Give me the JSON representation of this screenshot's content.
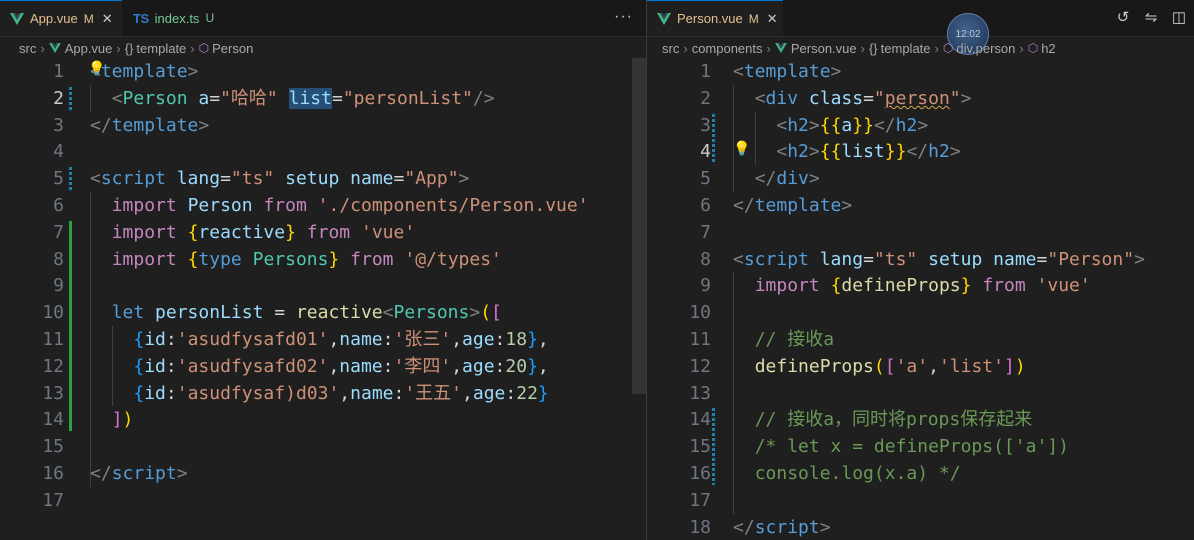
{
  "left": {
    "tabs": [
      {
        "name": "App.vue",
        "status": "M",
        "kind": "vue",
        "active": true
      },
      {
        "name": "index.ts",
        "status": "U",
        "kind": "ts",
        "active": false
      }
    ],
    "more": "···",
    "breadcrumb": [
      "src",
      "App.vue",
      "template",
      "Person"
    ],
    "lines": [
      {
        "n": "1",
        "tokens": [
          [
            "t-punc",
            "<"
          ],
          [
            "t-tag",
            "template"
          ],
          [
            "t-punc",
            ">"
          ]
        ]
      },
      {
        "n": "2",
        "tokens": [
          [
            "t-def",
            "  "
          ],
          [
            "t-punc",
            "<"
          ],
          [
            "t-type",
            "Person"
          ],
          [
            "t-def",
            " "
          ],
          [
            "t-attr",
            "a"
          ],
          [
            "t-def",
            "="
          ],
          [
            "t-str",
            "\"哈哈\""
          ],
          [
            "t-def",
            " "
          ],
          [
            "t-attr hl",
            "list"
          ],
          [
            "t-def",
            "="
          ],
          [
            "t-str",
            "\"personList\""
          ],
          [
            "t-punc",
            "/>"
          ]
        ]
      },
      {
        "n": "3",
        "tokens": [
          [
            "t-punc",
            "</"
          ],
          [
            "t-tag",
            "template"
          ],
          [
            "t-punc",
            ">"
          ]
        ]
      },
      {
        "n": "4",
        "tokens": []
      },
      {
        "n": "5",
        "tokens": [
          [
            "t-punc",
            "<"
          ],
          [
            "t-tag",
            "script"
          ],
          [
            "t-def",
            " "
          ],
          [
            "t-attr",
            "lang"
          ],
          [
            "t-def",
            "="
          ],
          [
            "t-str",
            "\"ts\""
          ],
          [
            "t-def",
            " "
          ],
          [
            "t-attr",
            "setup"
          ],
          [
            "t-def",
            " "
          ],
          [
            "t-attr",
            "name"
          ],
          [
            "t-def",
            "="
          ],
          [
            "t-str",
            "\"App\""
          ],
          [
            "t-punc",
            ">"
          ]
        ]
      },
      {
        "n": "6",
        "tokens": [
          [
            "t-def",
            "  "
          ],
          [
            "t-kw",
            "import"
          ],
          [
            "t-def",
            " "
          ],
          [
            "t-var",
            "Person"
          ],
          [
            "t-def",
            " "
          ],
          [
            "t-kw",
            "from"
          ],
          [
            "t-def",
            " "
          ],
          [
            "t-str",
            "'./components/Person.vue'"
          ]
        ]
      },
      {
        "n": "7",
        "tokens": [
          [
            "t-def",
            "  "
          ],
          [
            "t-kw",
            "import"
          ],
          [
            "t-def",
            " "
          ],
          [
            "t-br1",
            "{"
          ],
          [
            "t-var",
            "reactive"
          ],
          [
            "t-br1",
            "}"
          ],
          [
            "t-def",
            " "
          ],
          [
            "t-kw",
            "from"
          ],
          [
            "t-def",
            " "
          ],
          [
            "t-str",
            "'vue'"
          ]
        ]
      },
      {
        "n": "8",
        "tokens": [
          [
            "t-def",
            "  "
          ],
          [
            "t-kw",
            "import"
          ],
          [
            "t-def",
            " "
          ],
          [
            "t-br1",
            "{"
          ],
          [
            "t-let",
            "type"
          ],
          [
            "t-def",
            " "
          ],
          [
            "t-type",
            "Persons"
          ],
          [
            "t-br1",
            "}"
          ],
          [
            "t-def",
            " "
          ],
          [
            "t-kw",
            "from"
          ],
          [
            "t-def",
            " "
          ],
          [
            "t-str",
            "'@/types'"
          ]
        ]
      },
      {
        "n": "9",
        "tokens": []
      },
      {
        "n": "10",
        "tokens": [
          [
            "t-def",
            "  "
          ],
          [
            "t-let",
            "let"
          ],
          [
            "t-def",
            " "
          ],
          [
            "t-var",
            "personList"
          ],
          [
            "t-def",
            " = "
          ],
          [
            "t-fn",
            "reactive"
          ],
          [
            "t-punc",
            "<"
          ],
          [
            "t-type",
            "Persons"
          ],
          [
            "t-punc",
            ">"
          ],
          [
            "t-br1",
            "("
          ],
          [
            "t-br2",
            "["
          ]
        ]
      },
      {
        "n": "11",
        "tokens": [
          [
            "t-def",
            "    "
          ],
          [
            "t-br3",
            "{"
          ],
          [
            "t-var",
            "id"
          ],
          [
            "t-def",
            ":"
          ],
          [
            "t-str",
            "'asudfysafd01'"
          ],
          [
            "t-def",
            ","
          ],
          [
            "t-var",
            "name"
          ],
          [
            "t-def",
            ":"
          ],
          [
            "t-str",
            "'张三'"
          ],
          [
            "t-def",
            ","
          ],
          [
            "t-var",
            "age"
          ],
          [
            "t-def",
            ":"
          ],
          [
            "t-num",
            "18"
          ],
          [
            "t-br3",
            "}"
          ],
          [
            "t-def",
            ","
          ]
        ]
      },
      {
        "n": "12",
        "tokens": [
          [
            "t-def",
            "    "
          ],
          [
            "t-br3",
            "{"
          ],
          [
            "t-var",
            "id"
          ],
          [
            "t-def",
            ":"
          ],
          [
            "t-str",
            "'asudfysafd02'"
          ],
          [
            "t-def",
            ","
          ],
          [
            "t-var",
            "name"
          ],
          [
            "t-def",
            ":"
          ],
          [
            "t-str",
            "'李四'"
          ],
          [
            "t-def",
            ","
          ],
          [
            "t-var",
            "age"
          ],
          [
            "t-def",
            ":"
          ],
          [
            "t-num",
            "20"
          ],
          [
            "t-br3",
            "}"
          ],
          [
            "t-def",
            ","
          ]
        ]
      },
      {
        "n": "13",
        "tokens": [
          [
            "t-def",
            "    "
          ],
          [
            "t-br3",
            "{"
          ],
          [
            "t-var",
            "id"
          ],
          [
            "t-def",
            ":"
          ],
          [
            "t-str",
            "'asudfysaf)d03'"
          ],
          [
            "t-def",
            ","
          ],
          [
            "t-var",
            "name"
          ],
          [
            "t-def",
            ":"
          ],
          [
            "t-str",
            "'王五'"
          ],
          [
            "t-def",
            ","
          ],
          [
            "t-var",
            "age"
          ],
          [
            "t-def",
            ":"
          ],
          [
            "t-num",
            "22"
          ],
          [
            "t-br3",
            "}"
          ]
        ]
      },
      {
        "n": "14",
        "tokens": [
          [
            "t-def",
            "  "
          ],
          [
            "t-br2",
            "]"
          ],
          [
            "t-br1",
            ")"
          ]
        ]
      },
      {
        "n": "15",
        "tokens": []
      },
      {
        "n": "16",
        "tokens": [
          [
            "t-punc",
            "</"
          ],
          [
            "t-tag",
            "script"
          ],
          [
            "t-punc",
            ">"
          ]
        ]
      },
      {
        "n": "17",
        "tokens": []
      }
    ],
    "current_line": "2"
  },
  "right": {
    "tabs": [
      {
        "name": "Person.vue",
        "status": "M",
        "kind": "vue",
        "active": true
      }
    ],
    "clock_text": "12:02",
    "breadcrumb": [
      "src",
      "components",
      "Person.vue",
      "template",
      "div.person",
      "h2"
    ],
    "lines": [
      {
        "n": "1",
        "tokens": [
          [
            "t-punc",
            "<"
          ],
          [
            "t-tag",
            "template"
          ],
          [
            "t-punc",
            ">"
          ]
        ]
      },
      {
        "n": "2",
        "tokens": [
          [
            "t-def",
            "  "
          ],
          [
            "t-punc",
            "<"
          ],
          [
            "t-tag",
            "div"
          ],
          [
            "t-def",
            " "
          ],
          [
            "t-attr",
            "class"
          ],
          [
            "t-def",
            "="
          ],
          [
            "t-str",
            "\""
          ],
          [
            "t-str squiggle",
            "person"
          ],
          [
            "t-str",
            "\""
          ],
          [
            "t-punc",
            ">"
          ]
        ]
      },
      {
        "n": "3",
        "tokens": [
          [
            "t-def",
            "    "
          ],
          [
            "t-punc",
            "<"
          ],
          [
            "t-tag",
            "h2"
          ],
          [
            "t-punc",
            ">"
          ],
          [
            "t-br1",
            "{{"
          ],
          [
            "t-var",
            "a"
          ],
          [
            "t-br1",
            "}}"
          ],
          [
            "t-punc",
            "</"
          ],
          [
            "t-tag",
            "h2"
          ],
          [
            "t-punc",
            ">"
          ]
        ]
      },
      {
        "n": "4",
        "tokens": [
          [
            "t-def",
            "    "
          ],
          [
            "t-punc",
            "<"
          ],
          [
            "t-tag",
            "h2"
          ],
          [
            "t-punc",
            ">"
          ],
          [
            "t-br1",
            "{{"
          ],
          [
            "t-var",
            "list"
          ],
          [
            "t-br1",
            "}}"
          ],
          [
            "t-punc",
            "</"
          ],
          [
            "t-tag",
            "h2"
          ],
          [
            "t-punc",
            ">"
          ]
        ]
      },
      {
        "n": "5",
        "tokens": [
          [
            "t-def",
            "  "
          ],
          [
            "t-punc",
            "</"
          ],
          [
            "t-tag",
            "div"
          ],
          [
            "t-punc",
            ">"
          ]
        ]
      },
      {
        "n": "6",
        "tokens": [
          [
            "t-punc",
            "</"
          ],
          [
            "t-tag",
            "template"
          ],
          [
            "t-punc",
            ">"
          ]
        ]
      },
      {
        "n": "7",
        "tokens": []
      },
      {
        "n": "8",
        "tokens": [
          [
            "t-punc",
            "<"
          ],
          [
            "t-tag",
            "script"
          ],
          [
            "t-def",
            " "
          ],
          [
            "t-attr",
            "lang"
          ],
          [
            "t-def",
            "="
          ],
          [
            "t-str",
            "\"ts\""
          ],
          [
            "t-def",
            " "
          ],
          [
            "t-attr",
            "setup"
          ],
          [
            "t-def",
            " "
          ],
          [
            "t-attr",
            "name"
          ],
          [
            "t-def",
            "="
          ],
          [
            "t-str",
            "\"Person\""
          ],
          [
            "t-punc",
            ">"
          ]
        ]
      },
      {
        "n": "9",
        "tokens": [
          [
            "t-def",
            "  "
          ],
          [
            "t-kw",
            "import"
          ],
          [
            "t-def",
            " "
          ],
          [
            "t-br1",
            "{"
          ],
          [
            "t-fn",
            "defineProps"
          ],
          [
            "t-br1",
            "}"
          ],
          [
            "t-def",
            " "
          ],
          [
            "t-kw",
            "from"
          ],
          [
            "t-def",
            " "
          ],
          [
            "t-str",
            "'vue'"
          ]
        ]
      },
      {
        "n": "10",
        "tokens": []
      },
      {
        "n": "11",
        "tokens": [
          [
            "t-def",
            "  "
          ],
          [
            "t-com",
            "// 接收a"
          ]
        ]
      },
      {
        "n": "12",
        "tokens": [
          [
            "t-def",
            "  "
          ],
          [
            "t-fn",
            "defineProps"
          ],
          [
            "t-br1",
            "("
          ],
          [
            "t-br2",
            "["
          ],
          [
            "t-str",
            "'a'"
          ],
          [
            "t-def",
            ","
          ],
          [
            "t-str",
            "'list'"
          ],
          [
            "t-br2",
            "]"
          ],
          [
            "t-br1",
            ")"
          ]
        ]
      },
      {
        "n": "13",
        "tokens": []
      },
      {
        "n": "14",
        "tokens": [
          [
            "t-def",
            "  "
          ],
          [
            "t-com",
            "// 接收a，同时将props保存起来"
          ]
        ]
      },
      {
        "n": "15",
        "tokens": [
          [
            "t-def",
            "  "
          ],
          [
            "t-com",
            "/* let x = defineProps(['a'])"
          ]
        ]
      },
      {
        "n": "16",
        "tokens": [
          [
            "t-def",
            "  "
          ],
          [
            "t-com",
            "console.log(x.a) */"
          ]
        ]
      },
      {
        "n": "17",
        "tokens": []
      },
      {
        "n": "18",
        "tokens": [
          [
            "t-punc",
            "</"
          ],
          [
            "t-tag",
            "script"
          ],
          [
            "t-punc",
            ">"
          ]
        ]
      }
    ],
    "current_line": "4"
  },
  "colors": {
    "vue": "#41b883",
    "ts": "#3178c6",
    "accent": "#0078d4"
  },
  "icons": [
    "vue-file-icon",
    "ts-file-icon",
    "close-icon",
    "more-actions-icon",
    "timeline-icon",
    "compare-icon",
    "split-editor-icon",
    "lightbulb-icon",
    "symbol-icon"
  ]
}
